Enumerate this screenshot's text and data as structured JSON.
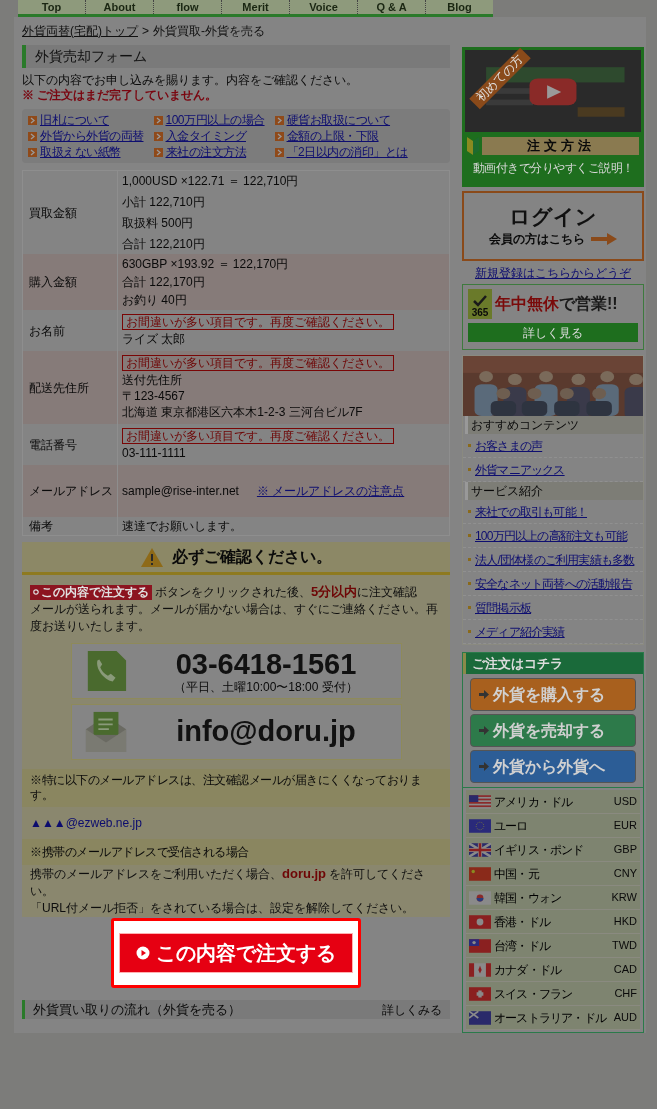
{
  "nav": [
    "Top",
    "About",
    "flow",
    "Merit",
    "Voice",
    "Q & A",
    "Blog"
  ],
  "breadcrumb": {
    "link": "外貨両替(宅配)トップ",
    "separator": ">",
    "current": "外貨買取-外貨を売る"
  },
  "title": "外貨売却フォーム",
  "intro": "以下の内容でお申し込みを賜ります。内容をご確認ください。",
  "warning": "※ ご注文はまだ完了していません。",
  "links": [
    "旧札について",
    "外貨から外貨の両替",
    "取扱えない紙幣",
    "100万円以上の場合",
    "入金タイミング",
    "来社の注文方法",
    "硬貨お取扱について",
    "金額の上限・下限",
    "「2日以内の消印」とは"
  ],
  "rows": [
    {
      "label": "買取金額",
      "lines": [
        "1,000USD ×122.71 ＝ 122,710円",
        "小計  122,710円",
        "取扱料  500円",
        "合計  122,210円"
      ]
    },
    {
      "label": "購入金額",
      "lines": [
        "630GBP ×193.92 ＝ 122,170円",
        "合計  122,170円",
        "お釣り  40円"
      ]
    },
    {
      "label": "お名前",
      "error": "お間違いが多い項目です。再度ご確認ください。",
      "lines": [
        "ライズ 太郎"
      ]
    },
    {
      "label": "配送先住所",
      "error": "お間違いが多い項目です。再度ご確認ください。",
      "lines": [
        "送付先住所",
        "〒123-4567",
        "北海道 東京都港区六本木1-2-3 三河台ビル7F"
      ]
    },
    {
      "label": "電話番号",
      "error": "お間違いが多い項目です。再度ご確認ください。",
      "lines": [
        "03-111-1111"
      ]
    },
    {
      "label": "メールアドレス",
      "lines": [
        "sample@rise-inter.net"
      ],
      "link": "※ メールアドレスの注意点"
    },
    {
      "label": "備考",
      "lines": [
        "速達でお願いします。"
      ]
    }
  ],
  "confirm": {
    "heading": "必ずご確認ください。",
    "badge": "この内容で注文する",
    "line1_before": "ボタンをクリックされた後、",
    "highlight": "5分以内",
    "line1_after": "に注文確認",
    "line2": "メールが送られます。メールが届かない場合は、すぐにご連絡ください。再度お送りいたします。",
    "phone": "03-6418-1561",
    "hours": "（平日、土曜10:00〜18:00 受付）",
    "email": "info@doru.jp"
  },
  "notices": [
    {
      "heading": "※特に以下のメールアドレスは、注文確認メールが届きにくくなっております。",
      "kind": "address",
      "lines": [
        "▲▲▲@ezweb.ne.jp"
      ]
    },
    {
      "heading": "※携帯のメールアドレスで受信される場合",
      "kind": "text",
      "lines": [
        "携帯のメールアドレスをご利用いただく場合、**doru.jp** を許可してください。",
        "「URL付メール拒否」をされている場合は、設定を解除してください。"
      ]
    }
  ],
  "submit": "この内容で注文する",
  "next_section": {
    "title": "外貨買い取りの流れ（外貨を売る）",
    "more": "詳しくみる"
  },
  "sidebar": {
    "video": {
      "ribbon": "初めての方",
      "label": "注文方法",
      "caption": "動画付きで分りやすくご説明！"
    },
    "login": {
      "title": "ログイン",
      "subtitle": "会員の方はこちら"
    },
    "register": "新規登録はこちらからどうぞ",
    "open": {
      "badge": "365",
      "highlight": "年中無休",
      "rest": "で営業!!",
      "button": "詳しく見る"
    },
    "groups": [
      {
        "heading": "おすすめコンテンツ",
        "links": [
          "お客さまの声",
          "外貨マニアックス"
        ]
      },
      {
        "heading": "サービス紹介",
        "links": [
          "来社での取引も可能！",
          "100万円以上の高額注文も可能",
          "法人/団体様のご利用実績も多数",
          "安全なネット両替への活動報告",
          "質問掲示板",
          "メディア紹介実績"
        ]
      }
    ],
    "order": {
      "heading": "ご注文はコチラ",
      "buttons": [
        {
          "label": "外貨を購入する",
          "color": "#a8601e"
        },
        {
          "label": "外貨を売却する",
          "color": "#2d7a4a"
        },
        {
          "label": "外貨から外貨へ",
          "color": "#2c5d96"
        }
      ]
    },
    "currencies": [
      {
        "name": "アメリカ・ドル",
        "code": "USD",
        "kind": "us"
      },
      {
        "name": "ユーロ",
        "code": "EUR",
        "kind": "eu"
      },
      {
        "name": "イギリス・ポンド",
        "code": "GBP",
        "kind": "uk"
      },
      {
        "name": "中国・元",
        "code": "CNY",
        "kind": "cn"
      },
      {
        "name": "韓国・ウォン",
        "code": "KRW",
        "kind": "kr"
      },
      {
        "name": "香港・ドル",
        "code": "HKD",
        "kind": "hk"
      },
      {
        "name": "台湾・ドル",
        "code": "TWD",
        "kind": "tw"
      },
      {
        "name": "カナダ・ドル",
        "code": "CAD",
        "kind": "ca"
      },
      {
        "name": "スイス・フラン",
        "code": "CHF",
        "kind": "ch"
      },
      {
        "name": "オーストラリア・ドル",
        "code": "AUD",
        "kind": "au"
      }
    ]
  }
}
